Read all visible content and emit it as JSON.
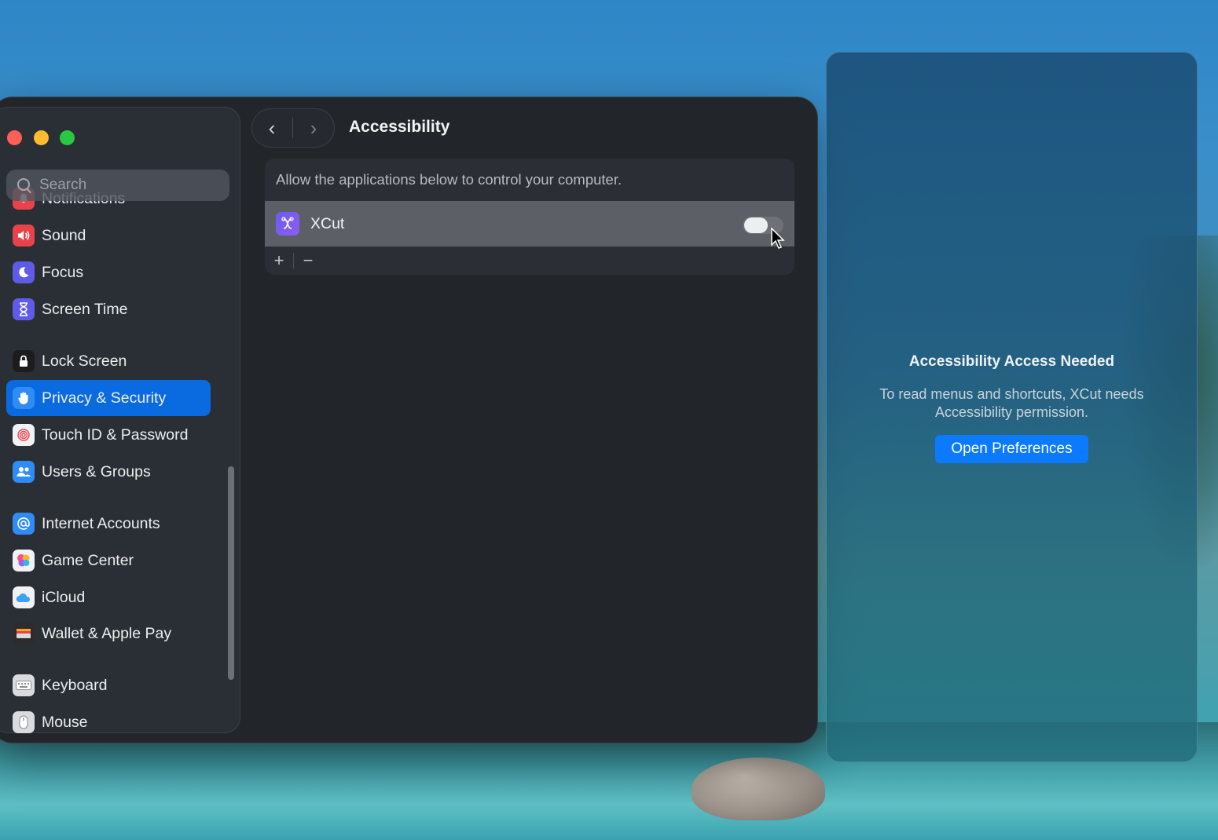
{
  "colors": {
    "accent": "#0a6be0",
    "button_blue": "#0b7aff",
    "window_bg": "#22262b",
    "sidebar_bg": "#2a2f35"
  },
  "sidebar": {
    "search": {
      "placeholder": "Search",
      "icon": "magnifier"
    },
    "items": [
      {
        "label": "Notifications",
        "icon": "bell-icon",
        "color": "#e8434b"
      },
      {
        "label": "Sound",
        "icon": "speaker-icon",
        "color": "#e8434b"
      },
      {
        "label": "Focus",
        "icon": "moon-icon",
        "color": "#5e5ce6"
      },
      {
        "label": "Screen Time",
        "icon": "hourglass-icon",
        "color": "#5e5ce6"
      },
      {
        "label": "Lock Screen",
        "icon": "lock-icon",
        "color": "#1c1c1e"
      },
      {
        "label": "Privacy & Security",
        "icon": "hand-icon",
        "color": "#2f8cf5",
        "selected": true
      },
      {
        "label": "Touch ID & Password",
        "icon": "fingerprint-icon",
        "color": "#f2f2f4"
      },
      {
        "label": "Users & Groups",
        "icon": "users-icon",
        "color": "#2f8cf5"
      },
      {
        "label": "Internet Accounts",
        "icon": "at-icon",
        "color": "#2f8cf5"
      },
      {
        "label": "Game Center",
        "icon": "game-center-icon",
        "color": "#f2f2f4"
      },
      {
        "label": "iCloud",
        "icon": "cloud-icon",
        "color": "#f2f2f4"
      },
      {
        "label": "Wallet & Apple Pay",
        "icon": "wallet-icon",
        "color": "#2c2c2e"
      },
      {
        "label": "Keyboard",
        "icon": "keyboard-icon",
        "color": "#d9dbde"
      },
      {
        "label": "Mouse",
        "icon": "mouse-icon",
        "color": "#d9dbde"
      }
    ]
  },
  "toolbar": {
    "back": "‹",
    "forward": "›",
    "title": "Accessibility"
  },
  "main": {
    "description": "Allow the applications below to control your computer.",
    "apps": [
      {
        "name": "XCut",
        "enabled": false
      }
    ],
    "add": "+",
    "remove": "−"
  },
  "alert": {
    "title": "Accessibility Access Needed",
    "body": "To read menus and shortcuts, XCut needs Accessibility permission.",
    "button": "Open Preferences"
  }
}
